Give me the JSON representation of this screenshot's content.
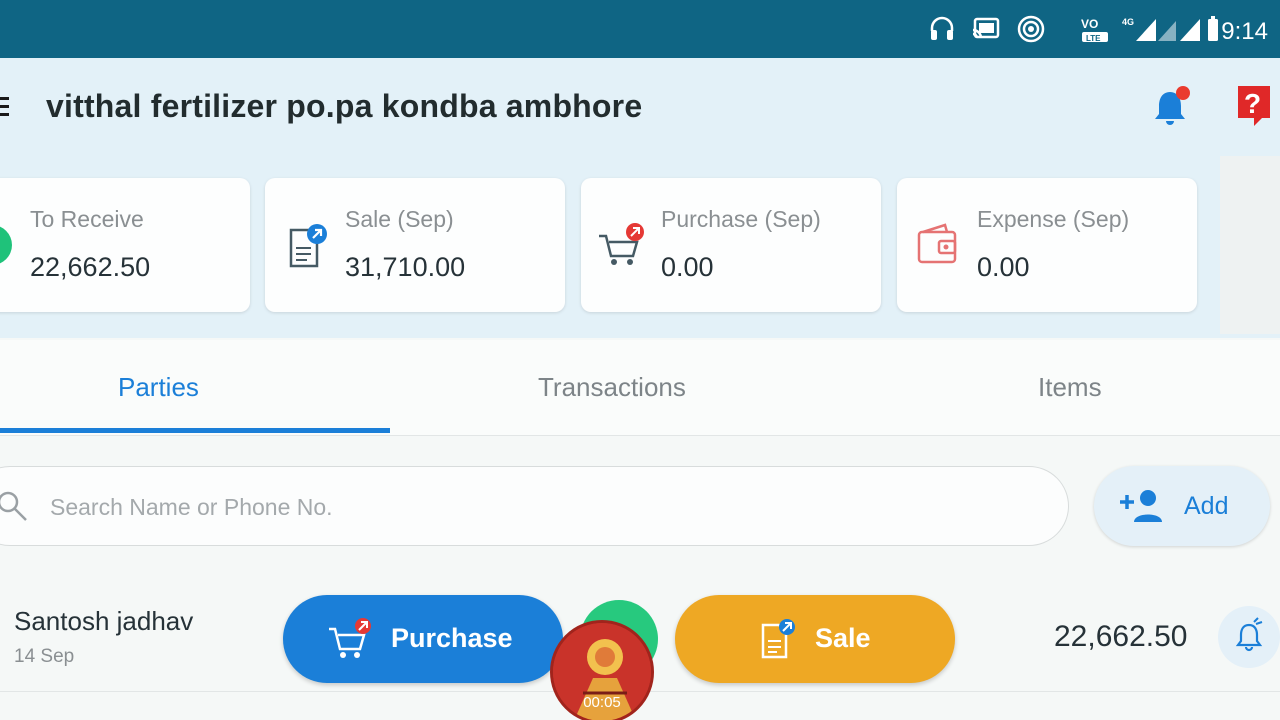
{
  "status_bar": {
    "time": "9:14",
    "icons": [
      "headphones-icon",
      "cast-icon",
      "hotspot-icon",
      "volte-icon",
      "signal-icon",
      "battery-icon"
    ]
  },
  "header": {
    "title": "vitthal fertilizer po.pa kondba ambhore",
    "notification_dot_color": "#ea3b2e"
  },
  "summary_cards": [
    {
      "label": "To Receive",
      "value": "22,662.50",
      "icon": "receive-icon",
      "color": "#1fc27a"
    },
    {
      "label": "Sale (Sep)",
      "value": "31,710.00",
      "icon": "sale-invoice-icon",
      "color": "#1b7fd8"
    },
    {
      "label": "Purchase (Sep)",
      "value": "0.00",
      "icon": "purchase-cart-icon",
      "color": "#e53935"
    },
    {
      "label": "Expense (Sep)",
      "value": "0.00",
      "icon": "wallet-icon",
      "color": "#e57373"
    }
  ],
  "tabs": [
    {
      "label": "Parties",
      "active": true
    },
    {
      "label": "Transactions",
      "active": false
    },
    {
      "label": "Items",
      "active": false
    }
  ],
  "search": {
    "placeholder": "Search Name or Phone No."
  },
  "add_button": {
    "label": "Add"
  },
  "parties": [
    {
      "name": "Santosh jadhav",
      "date": "14 Sep",
      "amount": "22,662.50"
    }
  ],
  "fab": {
    "purchase_label": "Purchase",
    "sale_label": "Sale"
  },
  "overlay": {
    "timer": "00:05"
  },
  "colors": {
    "status_bar": "#0f6584",
    "header_bg": "#e3f1f8",
    "accent_blue": "#1b7fd8",
    "sale_orange": "#eea824",
    "help_red": "#e02828"
  }
}
